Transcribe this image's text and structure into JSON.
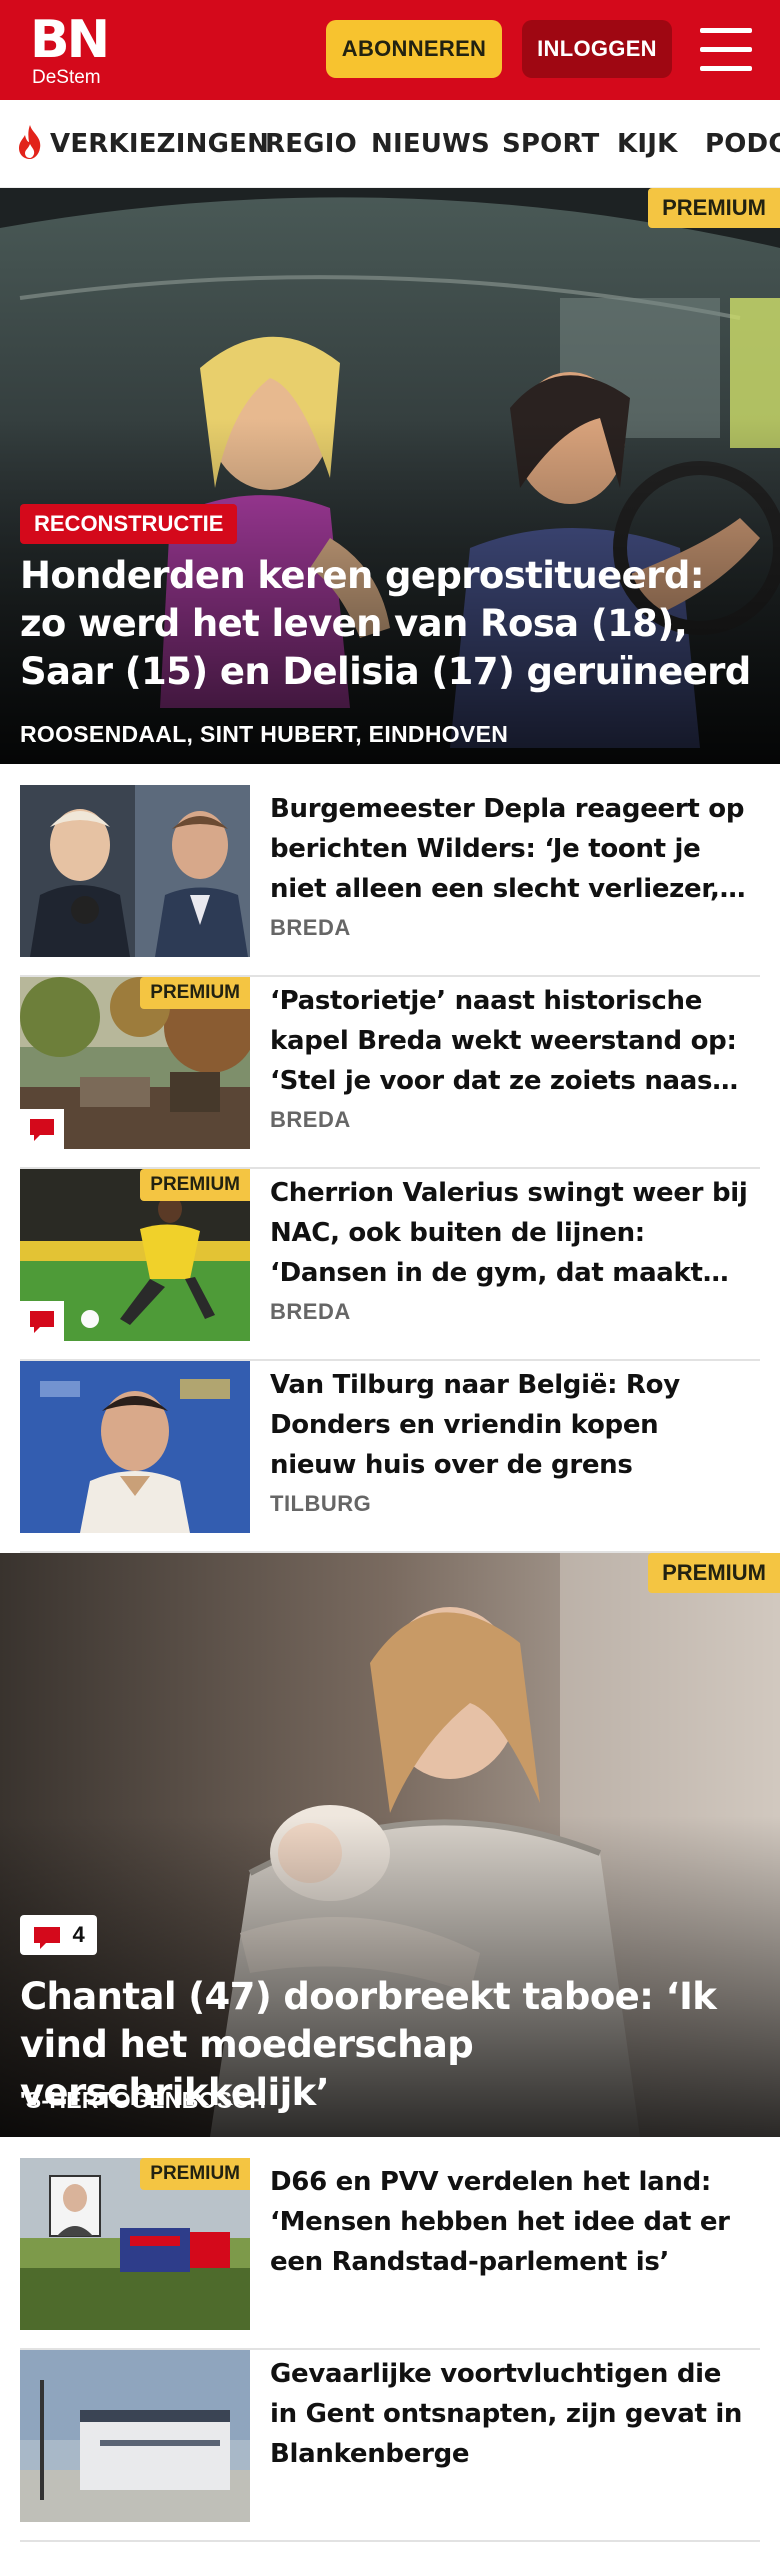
{
  "header": {
    "logo_main": "BN",
    "logo_sub": "DeStem",
    "subscribe_label": "ABONNEREN",
    "login_label": "INLOGGEN",
    "brand_color": "#d4091b"
  },
  "nav": {
    "items": [
      "VERKIEZINGEN",
      "REGIO",
      "NIEUWS",
      "SPORT",
      "KIJK",
      "PODC"
    ]
  },
  "hero1": {
    "premium_label": "PREMIUM",
    "tag": "RECONSTRUCTIE",
    "title": "Honderden keren geprostitueerd: zo werd het leven van Rosa (18), Saar (15) en Delisia (17) geruïneerd",
    "location": "ROOSENDAAL, SINT HUBERT, EINDHOVEN"
  },
  "articles": [
    {
      "title": "Burgemeester Depla reageert op berichten Wilders: ‘Je toont je niet alleen een slecht verliezer, maar ook een slechte leider’",
      "location": "BREDA",
      "premium": false,
      "comments": false
    },
    {
      "title": "‘Pastorietje’ naast historische kapel Breda wekt weerstand op: ‘Stel je voor dat ze zoiets naast je neerzetten’",
      "location": "BREDA",
      "premium": true,
      "premium_label": "PREMIUM",
      "comments": true
    },
    {
      "title": "Cherrion Valerius swingt weer bij NAC, ook buiten de lijnen: ‘Dansen in de gym, dat maakt me blij’",
      "location": "BREDA",
      "premium": true,
      "premium_label": "PREMIUM",
      "comments": true
    },
    {
      "title": "Van Tilburg naar België: Roy Donders en vriendin kopen nieuw huis over de grens",
      "location": "TILBURG",
      "premium": false,
      "comments": false
    }
  ],
  "hero2": {
    "premium_label": "PREMIUM",
    "comment_count": "4",
    "title": "Chantal (47) doorbreekt taboe: ‘Ik vind het moederschap verschrikkelijk’",
    "location": "'S-HERTOGENBOSCH"
  },
  "articles2": [
    {
      "title": "D66 en PVV verdelen het land: ‘Mensen hebben het idee dat er een Randstad-parlement is’",
      "premium": true,
      "premium_label": "PREMIUM"
    },
    {
      "title": "Gevaarlijke voortvluchtigen die in Gent ontsnapten, zijn gevat in Blankenberge",
      "premium": false
    }
  ]
}
